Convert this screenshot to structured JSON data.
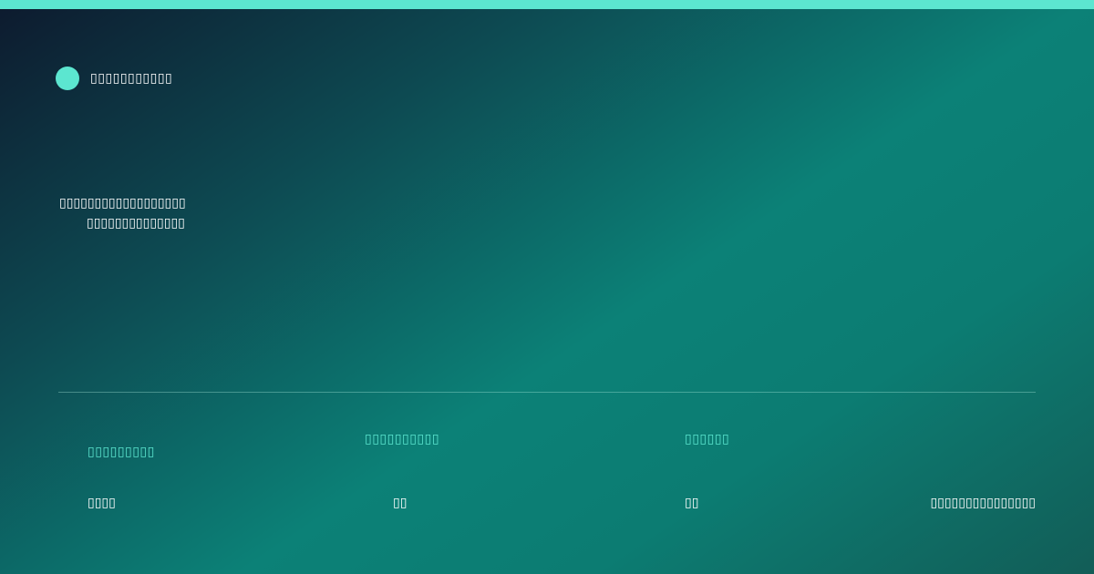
{
  "brand": {
    "name": "▯▯▯▯▯▯▯▯▯▯▯"
  },
  "headline": {
    "line1": "▯▯▯▯▯▯▯▯▯▯▯▯▯▯▯▯▯▯",
    "line2": "▯▯▯▯▯▯▯▯▯▯▯▯▯▯"
  },
  "stats": [
    {
      "label": "▯▯▯▯▯▯▯▯▯",
      "value": "▯▯▯▯"
    },
    {
      "label": "▯▯▯▯▯▯▯▯▯▯",
      "value": "▯▯"
    },
    {
      "label": "▯▯▯▯▯▯",
      "value": "▯▯"
    }
  ],
  "footer": {
    "text": "▯▯▯▯▯▯▯▯▯▯▯▯▯▯▯"
  },
  "colors": {
    "accent": "#5ce6d0",
    "gradient_dark": "#0d1a2e",
    "gradient_teal": "#0c8177",
    "text": "#ffffff"
  }
}
